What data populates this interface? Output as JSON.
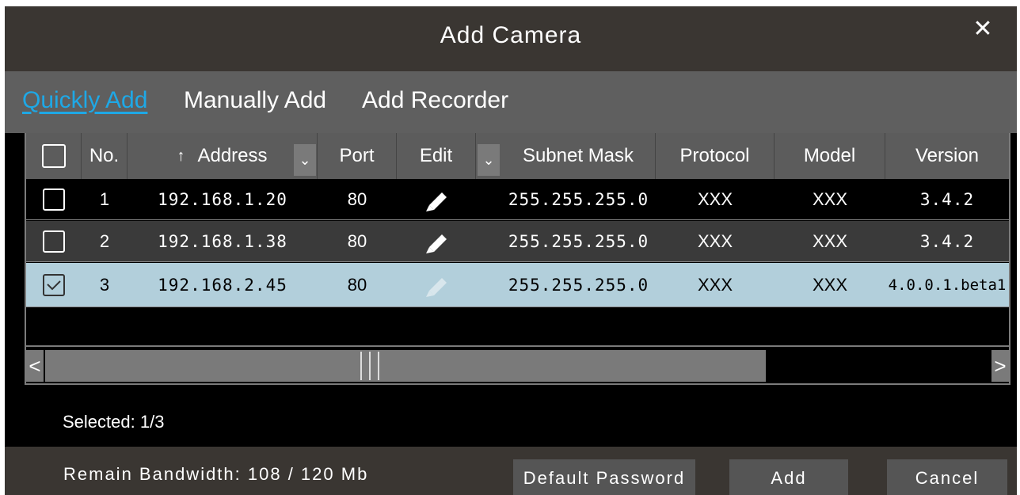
{
  "dialog": {
    "title": "Add Camera",
    "close_icon": "close-icon"
  },
  "tabs": [
    {
      "label": "Quickly Add",
      "active": true
    },
    {
      "label": "Manually Add",
      "active": false
    },
    {
      "label": "Add Recorder",
      "active": false
    }
  ],
  "table": {
    "headers": {
      "no": "No.",
      "address": "Address",
      "port": "Port",
      "edit": "Edit",
      "subnet_mask": "Subnet Mask",
      "protocol": "Protocol",
      "model": "Model",
      "version": "Version"
    },
    "rows": [
      {
        "checked": false,
        "no": "1",
        "address": "192.168.1.20",
        "port": "80",
        "subnet_mask": "255.255.255.0",
        "protocol": "XXX",
        "model": "XXX",
        "version": "3.4.2"
      },
      {
        "checked": false,
        "no": "2",
        "address": "192.168.1.38",
        "port": "80",
        "subnet_mask": "255.255.255.0",
        "protocol": "XXX",
        "model": "XXX",
        "version": "3.4.2"
      },
      {
        "checked": true,
        "no": "3",
        "address": "192.168.2.45",
        "port": "80",
        "subnet_mask": "255.255.255.0",
        "protocol": "XXX",
        "model": "XXX",
        "version": "4.0.0.1.beta1"
      }
    ]
  },
  "status": {
    "selected": "Selected: 1/3"
  },
  "footer": {
    "bandwidth": "Remain Bandwidth: 108 / 120 Mb",
    "default_password_label": "Default Password",
    "add_label": "Add",
    "cancel_label": "Cancel"
  },
  "colors": {
    "active_tab": "#1ea8e6",
    "selected_row": "#b2cfdb",
    "title_bar": "#3a3632",
    "tab_bar": "#5f5f5f"
  }
}
